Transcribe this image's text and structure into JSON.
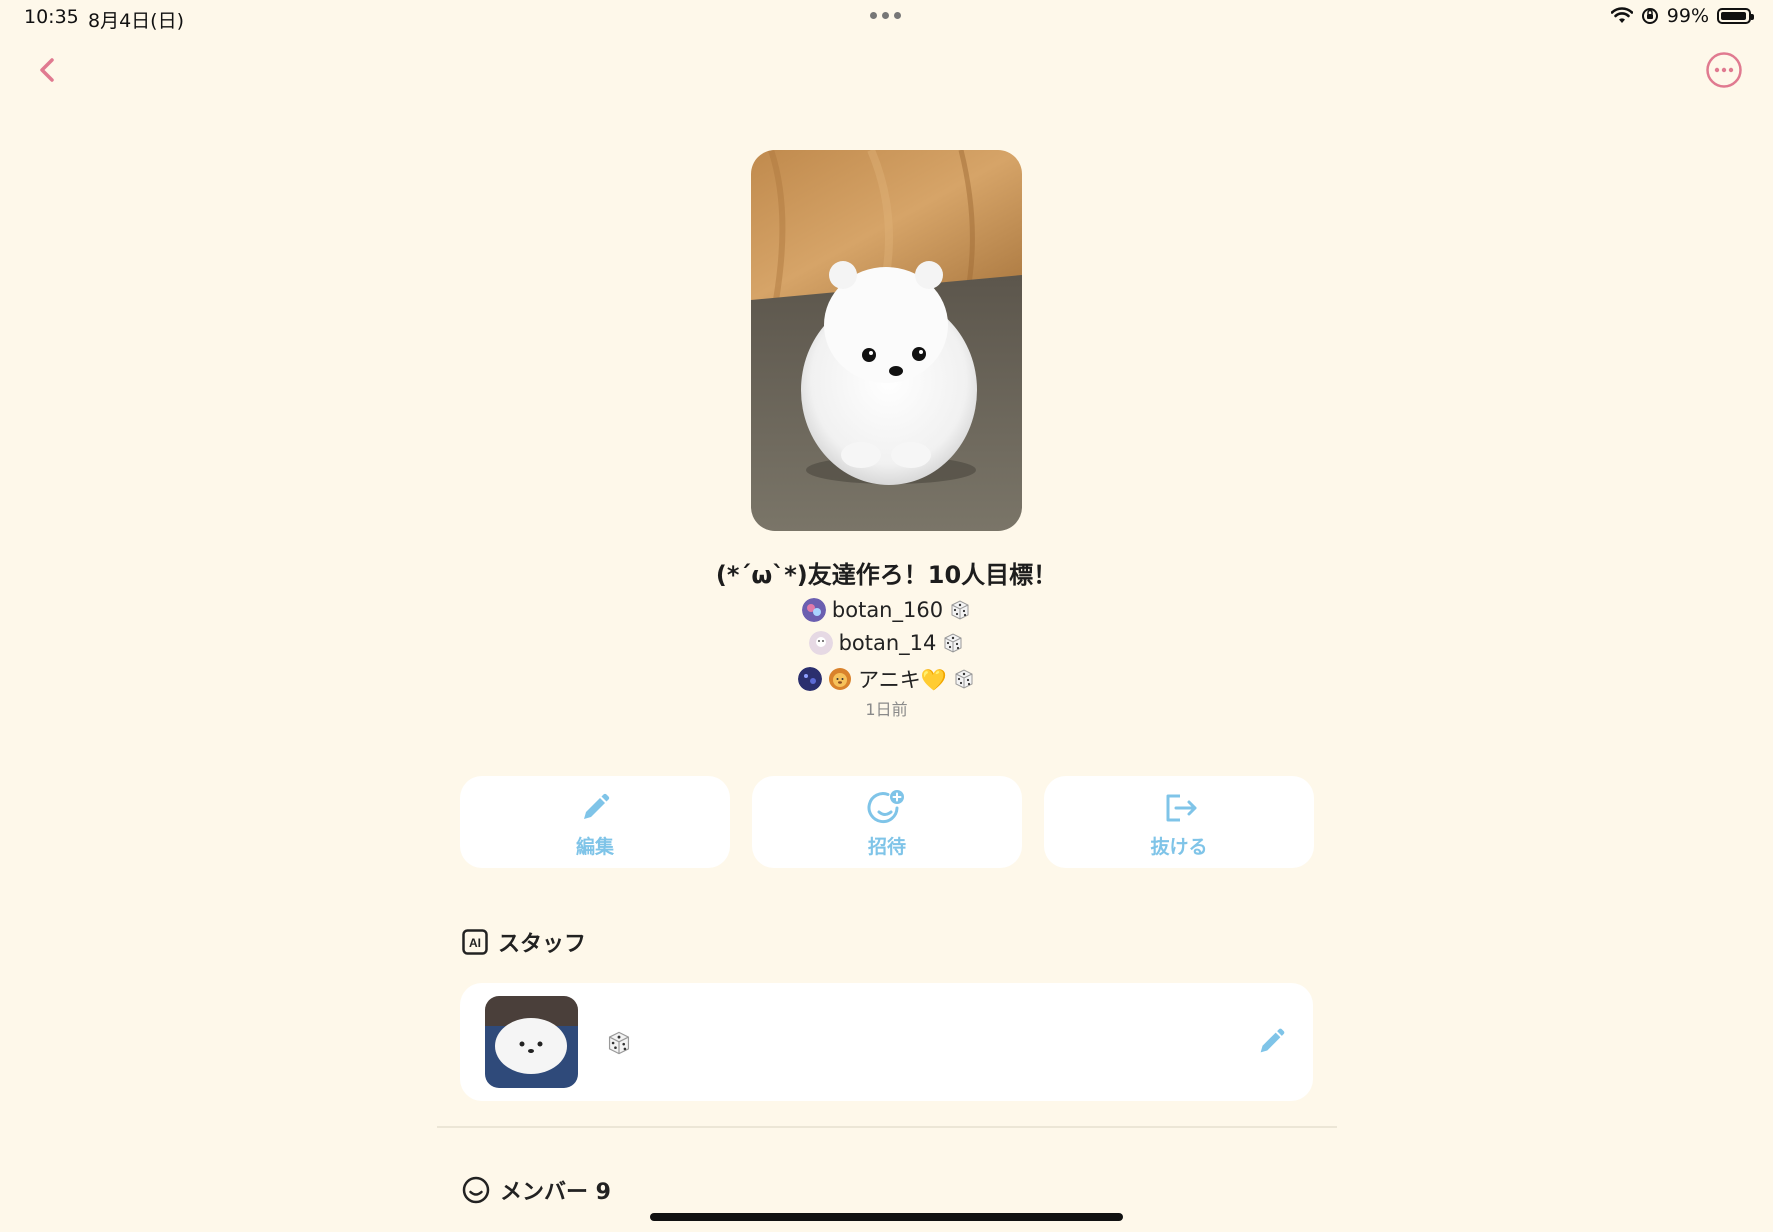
{
  "status_bar": {
    "time": "10:35",
    "date": "8月4日(日)",
    "battery": "99%"
  },
  "group": {
    "title": "(*´ω`*)友達作ろ！10人目標！",
    "posted": "1日前",
    "creators": [
      {
        "name": "botan_160"
      },
      {
        "name": "botan_14"
      },
      {
        "name": "アニキ💛"
      }
    ]
  },
  "actions": {
    "edit": "編集",
    "invite": "招待",
    "leave": "抜ける"
  },
  "staff_section": {
    "title": "スタッフ",
    "badge": "AI"
  },
  "members_section": {
    "title": "メンバー 9"
  },
  "colors": {
    "background": "#fef8ea",
    "accent_pink": "#e07a90",
    "accent_blue": "#7fc4e8"
  },
  "icons": [
    "back-chevron-icon",
    "more-options-icon",
    "pencil-icon",
    "invite-smile-icon",
    "exit-icon",
    "ai-badge-icon",
    "smile-icon",
    "dice-icon"
  ]
}
